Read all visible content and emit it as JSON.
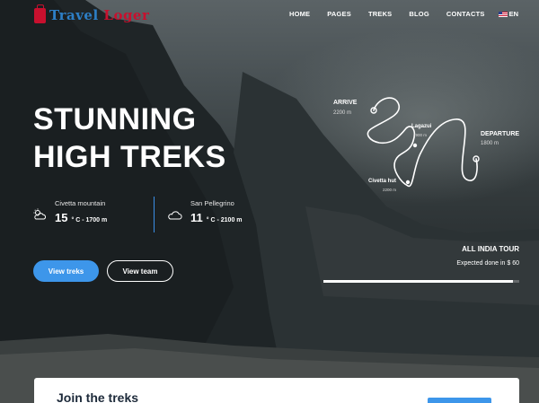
{
  "brand": {
    "name_part1": "Travel",
    "name_part2": "Loger"
  },
  "nav": {
    "items": [
      "HOME",
      "PAGES",
      "TREKS",
      "BLOG",
      "CONTACTS"
    ],
    "language": "EN"
  },
  "hero": {
    "title_line1": "STUNNING",
    "title_line2": "HIGH TREKS"
  },
  "weather": [
    {
      "location": "Civetta mountain",
      "temp": "15",
      "details": "° C - 1700 m",
      "icon": "sun-cloud-icon"
    },
    {
      "location": "San Pellegrino",
      "temp": "11",
      "details": "° C - 2100 m",
      "icon": "cloud-icon"
    }
  ],
  "buttons": {
    "primary": "View treks",
    "secondary": "View team"
  },
  "route": {
    "arrive": {
      "label": "ARRIVE",
      "altitude": "2200 m"
    },
    "lagazui": {
      "label": "Lagazui",
      "altitude": "1900 m"
    },
    "civetta_hut": {
      "label": "Civetta hut",
      "altitude": "2200 m"
    },
    "departure": {
      "label": "DEPARTURE",
      "altitude": "1800 m"
    }
  },
  "tour": {
    "title": "ALL INDIA TOUR",
    "subtitle": "Expected done in $ 60",
    "progress": 0.97
  },
  "card": {
    "title": "Join the treks"
  },
  "colors": {
    "accent": "#3d96ea",
    "brand_red": "#c8102e",
    "brand_blue": "#2d7fc6"
  }
}
